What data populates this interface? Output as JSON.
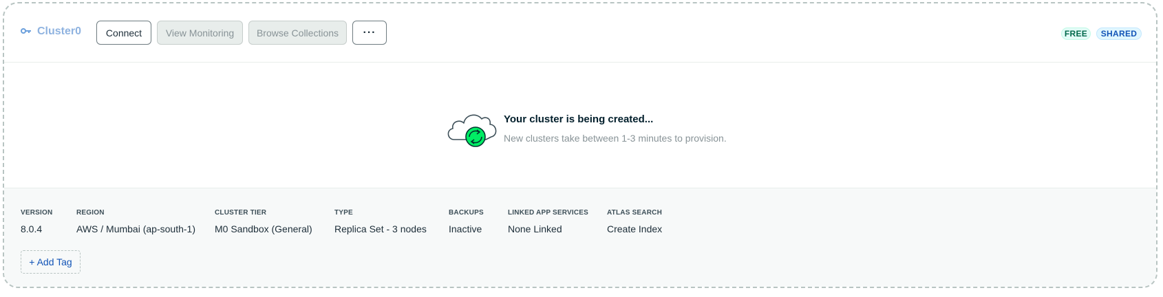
{
  "header": {
    "cluster_name": "Cluster0",
    "cluster_icon": "cluster-key-icon",
    "buttons": {
      "connect": "Connect",
      "view_monitoring": "View Monitoring",
      "browse_collections": "Browse Collections",
      "more": "···"
    },
    "badges": {
      "free": "FREE",
      "shared": "SHARED"
    }
  },
  "status": {
    "title": "Your cluster is being created...",
    "subtitle": "New clusters take between 1-3 minutes to provision.",
    "icon": "cloud-sync-icon"
  },
  "info": [
    {
      "key": "version",
      "label": "VERSION",
      "value": "8.0.4"
    },
    {
      "key": "region",
      "label": "REGION",
      "value": "AWS / Mumbai (ap-south-1)"
    },
    {
      "key": "cluster_tier",
      "label": "CLUSTER TIER",
      "value": "M0 Sandbox (General)"
    },
    {
      "key": "type",
      "label": "TYPE",
      "value": "Replica Set - 3 nodes"
    },
    {
      "key": "backups",
      "label": "BACKUPS",
      "value": "Inactive"
    },
    {
      "key": "linked_app_services",
      "label": "LINKED APP SERVICES",
      "value": "None Linked"
    },
    {
      "key": "atlas_search",
      "label": "ATLAS SEARCH",
      "value": "Create Index"
    }
  ],
  "add_tag_label": "+ Add Tag",
  "colors": {
    "link_blue": "#8fb3e0",
    "accent_green": "#00ed64",
    "badge_free_text": "#00684a",
    "badge_shared_text": "#1254b7"
  }
}
